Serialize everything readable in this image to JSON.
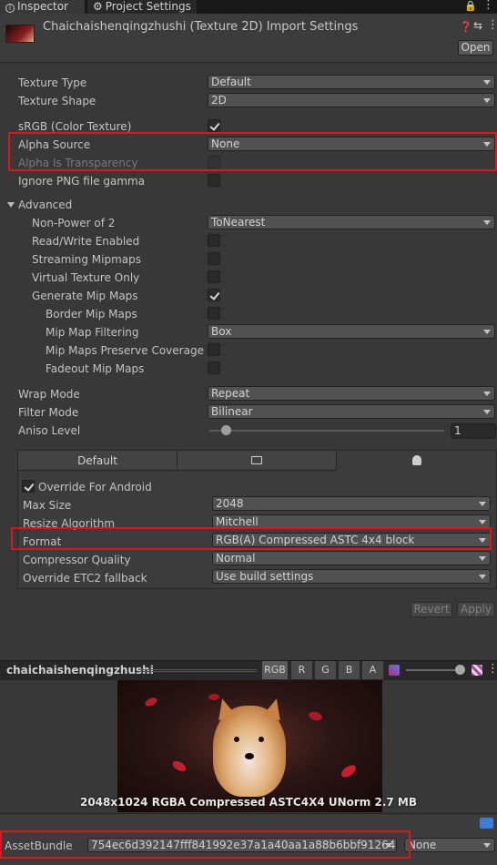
{
  "tabs": [
    {
      "label": "Inspector",
      "icon": "info-icon"
    },
    {
      "label": "Project Settings",
      "icon": "gear-icon"
    }
  ],
  "header": {
    "title": "Chaichaishenqingzhushi (Texture 2D) Import Settings",
    "open_label": "Open"
  },
  "settings": {
    "texture_type": {
      "label": "Texture Type",
      "value": "Default"
    },
    "texture_shape": {
      "label": "Texture Shape",
      "value": "2D"
    },
    "srgb": {
      "label": "sRGB (Color Texture)",
      "checked": true
    },
    "alpha_source": {
      "label": "Alpha Source",
      "value": "None"
    },
    "alpha_transparency": {
      "label": "Alpha Is Transparency",
      "checked": false
    },
    "ignore_png": {
      "label": "Ignore PNG file gamma",
      "checked": false
    },
    "advanced_label": "Advanced",
    "non_power_of_2": {
      "label": "Non-Power of 2",
      "value": "ToNearest"
    },
    "read_write": {
      "label": "Read/Write Enabled",
      "checked": false
    },
    "streaming_mipmaps": {
      "label": "Streaming Mipmaps",
      "checked": false
    },
    "virtual_texture": {
      "label": "Virtual Texture Only",
      "checked": false
    },
    "generate_mipmaps": {
      "label": "Generate Mip Maps",
      "checked": true
    },
    "border_mipmaps": {
      "label": "Border Mip Maps",
      "checked": false
    },
    "mipmap_filtering": {
      "label": "Mip Map Filtering",
      "value": "Box"
    },
    "mipmaps_coverage": {
      "label": "Mip Maps Preserve Coverage",
      "checked": false
    },
    "fadeout_mipmaps": {
      "label": "Fadeout Mip Maps",
      "checked": false
    },
    "wrap_mode": {
      "label": "Wrap Mode",
      "value": "Repeat"
    },
    "filter_mode": {
      "label": "Filter Mode",
      "value": "Bilinear"
    },
    "aniso_level": {
      "label": "Aniso Level",
      "value": "1",
      "slider_fraction": 0.0
    }
  },
  "platform": {
    "tabs": [
      {
        "label": "Default"
      },
      {
        "label": "",
        "icon": "monitor-icon"
      },
      {
        "label": "",
        "icon": "android-icon"
      }
    ],
    "override": {
      "label": "Override For Android",
      "checked": true
    },
    "max_size": {
      "label": "Max Size",
      "value": "2048"
    },
    "resize_algorithm": {
      "label": "Resize Algorithm",
      "value": "Mitchell"
    },
    "format": {
      "label": "Format",
      "value": "RGB(A) Compressed ASTC 4x4 block"
    },
    "compressor_quality": {
      "label": "Compressor Quality",
      "value": "Normal"
    },
    "override_etc2": {
      "label": "Override ETC2 fallback",
      "value": "Use build settings"
    }
  },
  "actions": {
    "revert_label": "Revert",
    "apply_label": "Apply"
  },
  "preview": {
    "name": "chaichaishenqingzhushi",
    "channels": [
      "RGB",
      "R",
      "G",
      "B",
      "A"
    ],
    "info": "2048x1024  RGBA Compressed ASTC4X4 UNorm  2.7 MB"
  },
  "assetbundle": {
    "label": "AssetBundle",
    "name_value": "754ec6d392147fff841992e37a1a40aa1a88b6bbf912641€",
    "variant_value": "None"
  },
  "colors": {
    "background": "#383838",
    "highlight": "#d7191c",
    "field": "#515151"
  }
}
